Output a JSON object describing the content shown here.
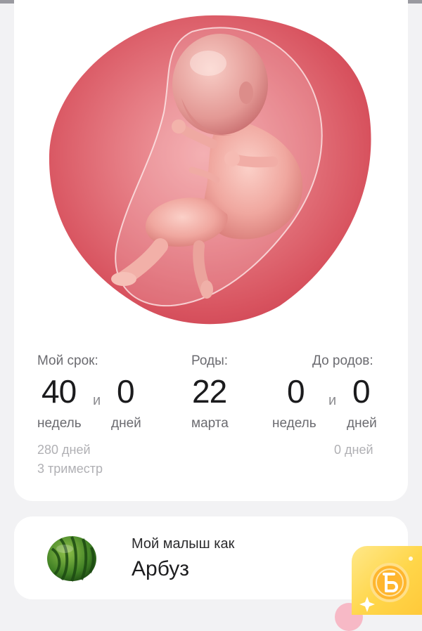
{
  "stats": {
    "my_term": {
      "label": "Мой срок:",
      "weeks": "40",
      "weeks_unit": "недель",
      "and": "и",
      "days": "0",
      "days_unit": "дней",
      "total_days": "280 дней",
      "trimester": "3 триместр"
    },
    "birth": {
      "label": "Роды:",
      "day": "22",
      "month": "марта"
    },
    "until_birth": {
      "label": "До родов:",
      "weeks": "0",
      "weeks_unit": "недель",
      "and": "и",
      "days": "0",
      "days_unit": "дней",
      "total_days": "0 дней"
    }
  },
  "baby_size": {
    "caption": "Мой малыш как",
    "fruit": "Арбуз",
    "icon": "watermelon-icon"
  },
  "bonus": {
    "icon": "bonus-coin-icon"
  },
  "colors": {
    "bonus_yellow": "#ffd64a",
    "womb_red": "#d95a66"
  }
}
